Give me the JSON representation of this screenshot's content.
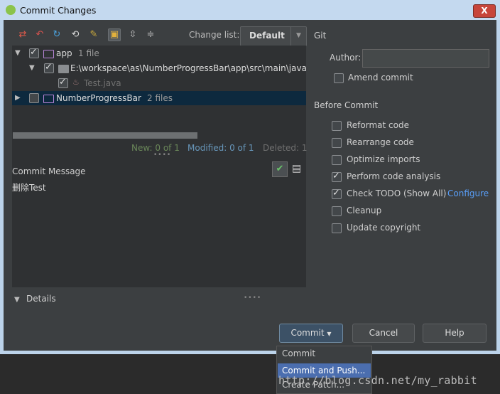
{
  "window": {
    "title": "Commit Changes",
    "close_label": "X"
  },
  "toolbar": {
    "changelist_label": "Change list:",
    "changelist_value": "Default"
  },
  "tree": {
    "rows": [
      {
        "name": "app",
        "count": "1 file"
      },
      {
        "name": "E:\\workspace\\as\\NumberProgressBar\\app\\src\\main\\java"
      },
      {
        "name": "Test.java"
      },
      {
        "name": "NumberProgressBar",
        "count": "2 files"
      }
    ]
  },
  "stats": {
    "new": "New: 0 of 1",
    "modified": "Modified: 0 of 1",
    "deleted": "Deleted: 1"
  },
  "message": {
    "label": "Commit Message",
    "text": "删除Test"
  },
  "details_label": "Details",
  "git": {
    "header": "Git",
    "author_label": "Author:",
    "author_value": "",
    "amend_label": "Amend commit"
  },
  "before_commit": {
    "header": "Before Commit",
    "options": [
      {
        "label": "Reformat code",
        "checked": false
      },
      {
        "label": "Rearrange code",
        "checked": false
      },
      {
        "label": "Optimize imports",
        "checked": false
      },
      {
        "label": "Perform code analysis",
        "checked": true
      },
      {
        "label": "Check TODO (Show All)",
        "checked": true,
        "link": "Configure"
      },
      {
        "label": "Cleanup",
        "checked": false
      },
      {
        "label": "Update copyright",
        "checked": false
      }
    ]
  },
  "buttons": {
    "commit": "Commit",
    "cancel": "Cancel",
    "help": "Help"
  },
  "popup": {
    "items": [
      "Commit",
      "Commit and Push...",
      "Create Patch..."
    ]
  },
  "watermark": "http://blog.csdn.net/my_rabbit"
}
